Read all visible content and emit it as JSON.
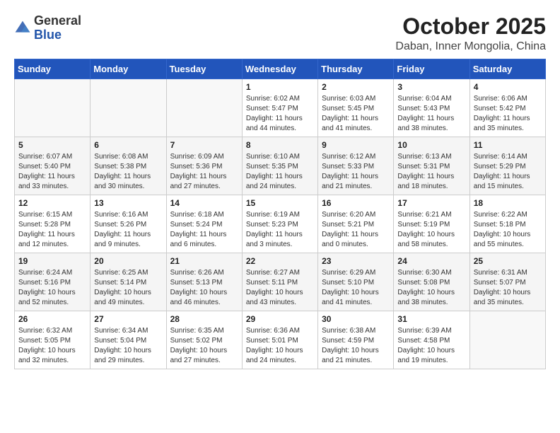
{
  "header": {
    "logo_general": "General",
    "logo_blue": "Blue",
    "month_title": "October 2025",
    "location": "Daban, Inner Mongolia, China"
  },
  "weekdays": [
    "Sunday",
    "Monday",
    "Tuesday",
    "Wednesday",
    "Thursday",
    "Friday",
    "Saturday"
  ],
  "weeks": [
    [
      {
        "day": "",
        "info": ""
      },
      {
        "day": "",
        "info": ""
      },
      {
        "day": "",
        "info": ""
      },
      {
        "day": "1",
        "info": "Sunrise: 6:02 AM\nSunset: 5:47 PM\nDaylight: 11 hours\nand 44 minutes."
      },
      {
        "day": "2",
        "info": "Sunrise: 6:03 AM\nSunset: 5:45 PM\nDaylight: 11 hours\nand 41 minutes."
      },
      {
        "day": "3",
        "info": "Sunrise: 6:04 AM\nSunset: 5:43 PM\nDaylight: 11 hours\nand 38 minutes."
      },
      {
        "day": "4",
        "info": "Sunrise: 6:06 AM\nSunset: 5:42 PM\nDaylight: 11 hours\nand 35 minutes."
      }
    ],
    [
      {
        "day": "5",
        "info": "Sunrise: 6:07 AM\nSunset: 5:40 PM\nDaylight: 11 hours\nand 33 minutes."
      },
      {
        "day": "6",
        "info": "Sunrise: 6:08 AM\nSunset: 5:38 PM\nDaylight: 11 hours\nand 30 minutes."
      },
      {
        "day": "7",
        "info": "Sunrise: 6:09 AM\nSunset: 5:36 PM\nDaylight: 11 hours\nand 27 minutes."
      },
      {
        "day": "8",
        "info": "Sunrise: 6:10 AM\nSunset: 5:35 PM\nDaylight: 11 hours\nand 24 minutes."
      },
      {
        "day": "9",
        "info": "Sunrise: 6:12 AM\nSunset: 5:33 PM\nDaylight: 11 hours\nand 21 minutes."
      },
      {
        "day": "10",
        "info": "Sunrise: 6:13 AM\nSunset: 5:31 PM\nDaylight: 11 hours\nand 18 minutes."
      },
      {
        "day": "11",
        "info": "Sunrise: 6:14 AM\nSunset: 5:29 PM\nDaylight: 11 hours\nand 15 minutes."
      }
    ],
    [
      {
        "day": "12",
        "info": "Sunrise: 6:15 AM\nSunset: 5:28 PM\nDaylight: 11 hours\nand 12 minutes."
      },
      {
        "day": "13",
        "info": "Sunrise: 6:16 AM\nSunset: 5:26 PM\nDaylight: 11 hours\nand 9 minutes."
      },
      {
        "day": "14",
        "info": "Sunrise: 6:18 AM\nSunset: 5:24 PM\nDaylight: 11 hours\nand 6 minutes."
      },
      {
        "day": "15",
        "info": "Sunrise: 6:19 AM\nSunset: 5:23 PM\nDaylight: 11 hours\nand 3 minutes."
      },
      {
        "day": "16",
        "info": "Sunrise: 6:20 AM\nSunset: 5:21 PM\nDaylight: 11 hours\nand 0 minutes."
      },
      {
        "day": "17",
        "info": "Sunrise: 6:21 AM\nSunset: 5:19 PM\nDaylight: 10 hours\nand 58 minutes."
      },
      {
        "day": "18",
        "info": "Sunrise: 6:22 AM\nSunset: 5:18 PM\nDaylight: 10 hours\nand 55 minutes."
      }
    ],
    [
      {
        "day": "19",
        "info": "Sunrise: 6:24 AM\nSunset: 5:16 PM\nDaylight: 10 hours\nand 52 minutes."
      },
      {
        "day": "20",
        "info": "Sunrise: 6:25 AM\nSunset: 5:14 PM\nDaylight: 10 hours\nand 49 minutes."
      },
      {
        "day": "21",
        "info": "Sunrise: 6:26 AM\nSunset: 5:13 PM\nDaylight: 10 hours\nand 46 minutes."
      },
      {
        "day": "22",
        "info": "Sunrise: 6:27 AM\nSunset: 5:11 PM\nDaylight: 10 hours\nand 43 minutes."
      },
      {
        "day": "23",
        "info": "Sunrise: 6:29 AM\nSunset: 5:10 PM\nDaylight: 10 hours\nand 41 minutes."
      },
      {
        "day": "24",
        "info": "Sunrise: 6:30 AM\nSunset: 5:08 PM\nDaylight: 10 hours\nand 38 minutes."
      },
      {
        "day": "25",
        "info": "Sunrise: 6:31 AM\nSunset: 5:07 PM\nDaylight: 10 hours\nand 35 minutes."
      }
    ],
    [
      {
        "day": "26",
        "info": "Sunrise: 6:32 AM\nSunset: 5:05 PM\nDaylight: 10 hours\nand 32 minutes."
      },
      {
        "day": "27",
        "info": "Sunrise: 6:34 AM\nSunset: 5:04 PM\nDaylight: 10 hours\nand 29 minutes."
      },
      {
        "day": "28",
        "info": "Sunrise: 6:35 AM\nSunset: 5:02 PM\nDaylight: 10 hours\nand 27 minutes."
      },
      {
        "day": "29",
        "info": "Sunrise: 6:36 AM\nSunset: 5:01 PM\nDaylight: 10 hours\nand 24 minutes."
      },
      {
        "day": "30",
        "info": "Sunrise: 6:38 AM\nSunset: 4:59 PM\nDaylight: 10 hours\nand 21 minutes."
      },
      {
        "day": "31",
        "info": "Sunrise: 6:39 AM\nSunset: 4:58 PM\nDaylight: 10 hours\nand 19 minutes."
      },
      {
        "day": "",
        "info": ""
      }
    ]
  ]
}
